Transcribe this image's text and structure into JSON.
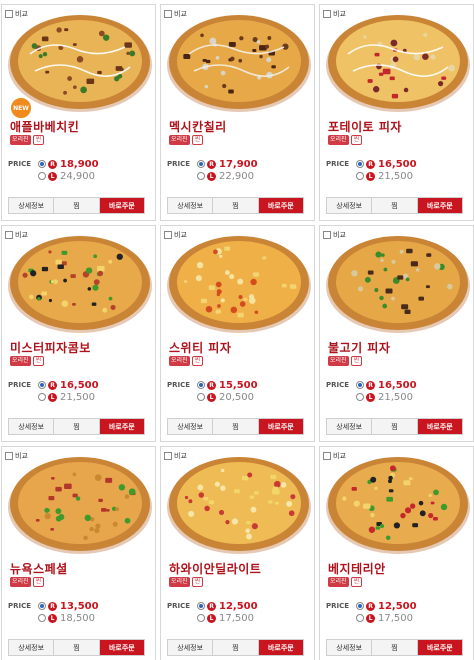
{
  "compare_label": "비교",
  "price_label": "PRICE",
  "size_regular": "R",
  "size_large": "L",
  "buttons": {
    "detail": "상세정보",
    "wish": "찜",
    "order": "바로주문"
  },
  "new_badge": "NEW",
  "colors": {
    "accent": "#c9151f",
    "name": "#b0121b",
    "tag": "#cf3a45"
  },
  "products": [
    {
      "name": "애플바베치킨",
      "tags": [
        "오리진",
        "씬"
      ],
      "price_r": "18,900",
      "price_l": "24,900",
      "is_new": true,
      "topping": "bbq"
    },
    {
      "name": "멕시칸칠리",
      "tags": [
        "오리진",
        "씬"
      ],
      "price_r": "17,900",
      "price_l": "22,900",
      "is_new": false,
      "topping": "chili"
    },
    {
      "name": "포테이토 피자",
      "tags": [
        "오리진",
        "씬"
      ],
      "price_r": "16,500",
      "price_l": "21,500",
      "is_new": false,
      "topping": "potato"
    },
    {
      "name": "미스터피자콤보",
      "tags": [
        "오리진",
        "씬"
      ],
      "price_r": "16,500",
      "price_l": "21,500",
      "is_new": false,
      "topping": "combo"
    },
    {
      "name": "스위티 피자",
      "tags": [
        "오리진",
        "씬"
      ],
      "price_r": "15,500",
      "price_l": "20,500",
      "is_new": false,
      "topping": "sweet"
    },
    {
      "name": "불고기 피자",
      "tags": [
        "오리진",
        "씬"
      ],
      "price_r": "16,500",
      "price_l": "21,500",
      "is_new": false,
      "topping": "bulgogi"
    },
    {
      "name": "뉴욕스페셜",
      "tags": [
        "오리진",
        "씬"
      ],
      "price_r": "13,500",
      "price_l": "18,500",
      "is_new": false,
      "topping": "newyork"
    },
    {
      "name": "하와이안딜라이트",
      "tags": [
        "오리진",
        "씬"
      ],
      "price_r": "12,500",
      "price_l": "17,500",
      "is_new": false,
      "topping": "hawaiian"
    },
    {
      "name": "베지테리안",
      "tags": [
        "오리진",
        "씬"
      ],
      "price_r": "12,500",
      "price_l": "17,500",
      "is_new": false,
      "topping": "veggie"
    }
  ]
}
